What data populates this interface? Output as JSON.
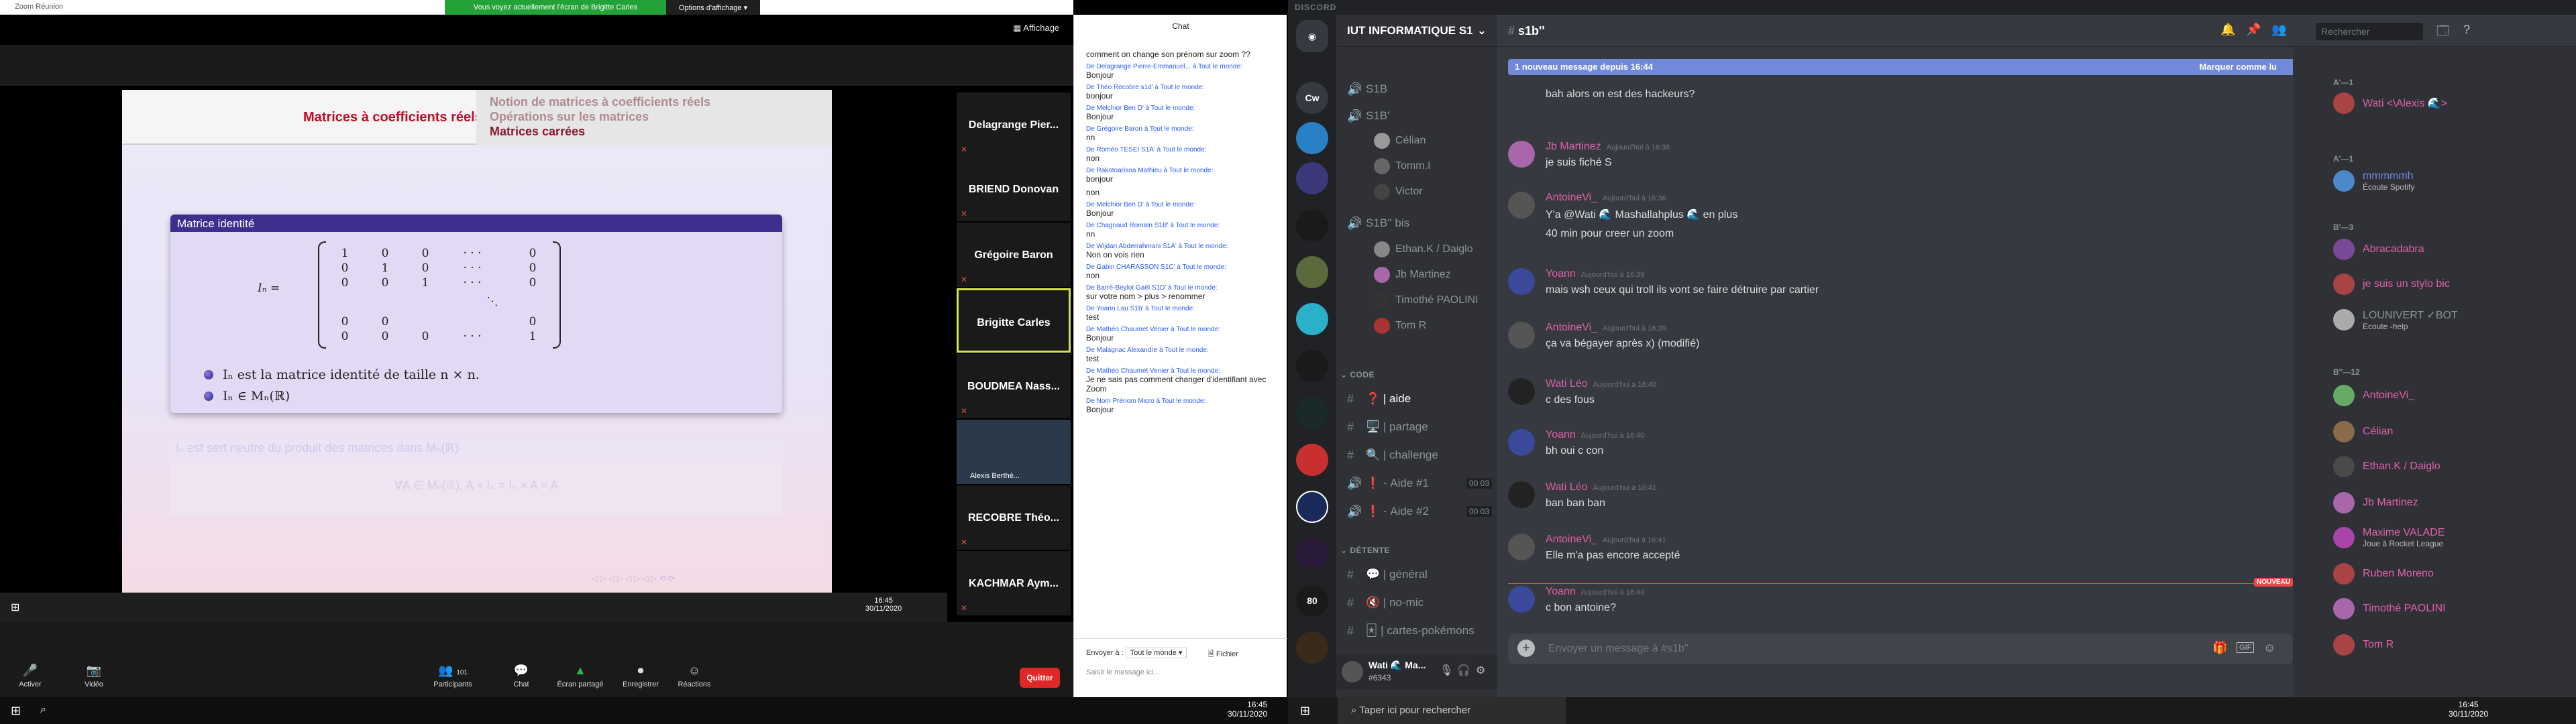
{
  "zoom": {
    "window_title": "Zoom Réunion",
    "share_banner": "Vous voyez actuellement l'écran de Brigitte Carles",
    "display_options": "Options d'affichage ▾",
    "view_button": "Affichage",
    "slide": {
      "title_left": "Matrices à coefficients réels",
      "title_right": [
        "Notion de matrices à coefficients réels",
        "Opérations sur les matrices",
        "Matrices carrées"
      ],
      "theorem_title": "Matrice identité",
      "matrix_label": "Iₙ =",
      "bullet1": "Iₙ est la matrice identité de taille n × n.",
      "bullet2": "Iₙ ∈ Mₙ(ℝ)",
      "faded1": "Iₙ est sert neutre du produit des matrices dans Mₙ(ℝ)",
      "faded2": "∀A ∈ Mₙ(ℝ), A × Iₙ = Iₙ × A = A"
    },
    "taskbar_time": "16:45",
    "taskbar_date": "30/11/2020",
    "participants": [
      "Delagrange Pier...",
      "BRIEND Donovan",
      "Grégoire Baron",
      "Brigitte Carles",
      "BOUDMEA Nass...",
      "Alexis Berthé...",
      "RECOBRE Théo...",
      "KACHMAR Aym..."
    ],
    "toolbar": {
      "activate": "Activer",
      "video": "Vidéo",
      "participants": "Participants",
      "participant_count": "101",
      "chat": "Chat",
      "share": "Écran partagé",
      "record": "Enregistrer",
      "reactions": "Réactions",
      "quit": "Quitter"
    },
    "chat": {
      "title": "Chat",
      "messages": [
        {
          "from": "",
          "text": "comment on change son prénom sur zoom ??"
        },
        {
          "from": "De Delagrange Pierre-Emmanuel... à Tout le monde:",
          "text": "Bonjour"
        },
        {
          "from": "De Théo Recobre s1d' à Tout le monde:",
          "text": "bonjour"
        },
        {
          "from": "De Melchior Ben D' à Tout le monde:",
          "text": "Bonjour"
        },
        {
          "from": "De Grégoire Baron à Tout le monde:",
          "text": "nn"
        },
        {
          "from": "De Roméo TESEI S1A' à Tout le monde:",
          "text": "non"
        },
        {
          "from": "De Rakotoarisoa Mathieu à Tout le monde:",
          "text": "bonjour"
        },
        {
          "from": "",
          "text": "non"
        },
        {
          "from": "De Melchior Ben D' à Tout le monde:",
          "text": "Bonjour"
        },
        {
          "from": "De Chagnaud Romain S1B' à Tout le monde:",
          "text": "nn"
        },
        {
          "from": "De Wijdan Abderrahmani S1A' à Tout le monde:",
          "text": "Non on vois rien"
        },
        {
          "from": "De Gabin CHARASSON S1C' à Tout le monde:",
          "text": "non"
        },
        {
          "from": "De Barré-Beylot Gaël S1D' à Tout le monde:",
          "text": "sur votre nom > plus > renommer"
        },
        {
          "from": "De Yoann Lau S1b' à Tout le monde:",
          "text": "test"
        },
        {
          "from": "De Mathéo Chaumet Venier à Tout le monde:",
          "text": "Bonjour"
        },
        {
          "from": "De Malagnac Alexandre à Tout le monde:",
          "text": "test"
        },
        {
          "from": "De Mathéo Chaumet Venier à Tout le monde:",
          "text": "Je ne sais pas comment changer d'identifiant avec Zoom"
        },
        {
          "from": "De Nom Prénom Micro à Tout le monde:",
          "text": "Bonjour"
        }
      ],
      "send_to_label": "Envoyer à :",
      "send_to_value": "Tout le monde ▾",
      "file_label": "Fichier",
      "input_placeholder": "Saisir le message ici..."
    },
    "left_taskbar_time": "16:45",
    "left_taskbar_date": "30/11/2020"
  },
  "discord": {
    "app_title": "DISCORD",
    "server_name": "IUT INFORMATIQUE S1",
    "channel_name": "s1b''",
    "search_placeholder": "Rechercher",
    "new_messages_banner": "1 nouveau message depuis 16:44",
    "mark_read": "Marquer comme lu",
    "channels": [
      {
        "name": "S1B",
        "type": "voice"
      },
      {
        "name": "S1B'",
        "type": "voice"
      },
      {
        "name": "S1B'' bis",
        "type": "voice"
      },
      {
        "name": "aide",
        "type": "text",
        "prefix": "❓"
      },
      {
        "name": "partage",
        "type": "text",
        "prefix": "🖥️"
      },
      {
        "name": "challenge",
        "type": "text",
        "prefix": "🔍"
      },
      {
        "name": "Aide #1",
        "type": "voice",
        "prefix": "❗",
        "counts": "00 03"
      },
      {
        "name": "Aide #2",
        "type": "voice",
        "prefix": "❗",
        "counts": "00 03"
      },
      {
        "name": "général",
        "type": "text",
        "prefix": "💬"
      },
      {
        "name": "no-mic",
        "type": "text",
        "prefix": "🔇"
      },
      {
        "name": "cartes-pokémons",
        "type": "text",
        "prefix": "🃏"
      }
    ],
    "categories": {
      "code": "CODE",
      "detente": "DÉTENTE"
    },
    "voice_users_s1b2": [
      "Célian",
      "Tomm.I",
      "Victor"
    ],
    "voice_users_bis": [
      "Ethan.K / Daiglo",
      "Jb Martinez",
      "Timothé PAOLINI",
      "Tom R"
    ],
    "user_panel": {
      "name": "Wati 🌊 Ma...",
      "tag": "#6343"
    },
    "messages": [
      {
        "author": "",
        "time": "",
        "text": "bah alors on est des hackeurs?",
        "color": "#dcddde"
      },
      {
        "author": "Jb Martinez",
        "time": "Aujourd'hui à 16:36",
        "text": "je suis fiché S",
        "color": "#e060a8"
      },
      {
        "author": "AntoineVi_",
        "time": "Aujourd'hui à 16:36",
        "text": "Y'a @Wati 🌊 Mashallahplus 🌊 en plus",
        "color": "#e060a8"
      },
      {
        "author": "",
        "time": "",
        "text": "40 min pour creer un zoom",
        "color": "#dcddde"
      },
      {
        "author": "Yoann",
        "time": "Aujourd'hui à 16:39",
        "text": "mais wsh ceux qui troll ils vont se faire détruire par cartier",
        "color": "#e060a8"
      },
      {
        "author": "AntoineVi_",
        "time": "Aujourd'hui à 16:39",
        "text": "ça va bégayer après x) (modifié)",
        "color": "#e060a8"
      },
      {
        "author": "Wati Léo",
        "time": "Aujourd'hui à 16:40",
        "text": "c des fous",
        "color": "#e060a8"
      },
      {
        "author": "Yoann",
        "time": "Aujourd'hui à 16:40",
        "text": "bh oui c con",
        "color": "#e060a8"
      },
      {
        "author": "Wati Léo",
        "time": "Aujourd'hui à 16:41",
        "text": "ban ban ban",
        "color": "#e060a8"
      },
      {
        "author": "AntoineVi_",
        "time": "Aujourd'hui à 16:41",
        "text": "Elle m'a pas encore accepté",
        "color": "#e060a8"
      },
      {
        "author": "Yoann",
        "time": "Aujourd'hui à 16:44",
        "text": "c bon antoine?",
        "color": "#e060a8"
      }
    ],
    "new_label": "NOUVEAU",
    "input_placeholder": "Envoyer un message à #s1b''",
    "member_categories": [
      "A'—1",
      "A'—1",
      "B'—3",
      "B''—12"
    ],
    "members": [
      {
        "name": "Wati <\\Alexis 🌊>",
        "sub": "",
        "color": "#e060a8"
      },
      {
        "name": "mmmmmh",
        "sub": "Écoute Spotify",
        "color": "#7289da"
      },
      {
        "name": "Abracadabra",
        "sub": "",
        "color": "#e060a8"
      },
      {
        "name": "je suis un stylo bic",
        "sub": "",
        "color": "#e060a8"
      },
      {
        "name": "LOUNIVERT ✓BOT",
        "sub": "Ecoute -help",
        "color": "#8e9297"
      },
      {
        "name": "AntoineVi_",
        "sub": "",
        "color": "#e060a8"
      },
      {
        "name": "Célian",
        "sub": "",
        "color": "#e060a8"
      },
      {
        "name": "Ethan.K / Daiglo",
        "sub": "",
        "color": "#e060a8"
      },
      {
        "name": "Jb Martinez",
        "sub": "",
        "color": "#e060a8"
      },
      {
        "name": "Maxime VALADE",
        "sub": "Joue à Rocket League",
        "color": "#e060a8"
      },
      {
        "name": "Ruben Moreno",
        "sub": "",
        "color": "#e060a8"
      },
      {
        "name": "Timothé PAOLINI",
        "sub": "",
        "color": "#e060a8"
      },
      {
        "name": "Tom R",
        "sub": "",
        "color": "#e060a8"
      }
    ],
    "taskbar_search": "Taper ici pour rechercher",
    "taskbar_time": "16:45",
    "taskbar_date": "30/11/2020"
  },
  "guilds": [
    "Cw"
  ]
}
